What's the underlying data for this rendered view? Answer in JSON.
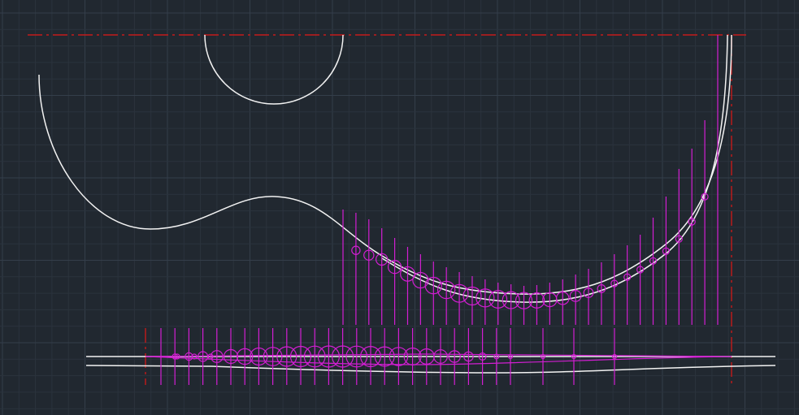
{
  "app": {
    "kind": "cad-drawing-viewport",
    "background": "#212830"
  },
  "layers": {
    "grid": {
      "minor_color": "#2b333d",
      "major_color": "#343e4a"
    },
    "geometry": {
      "color": "#f2f2f2"
    },
    "construction": {
      "color": "#d21ed2"
    },
    "centerline": {
      "color": "#c41a1a",
      "linetype": "dash-dot"
    }
  },
  "entities": {
    "circle_arc": "semicircle-arc",
    "spline": "s-curve-spline",
    "bowl_outer": "bowl-arc-outer",
    "bowl_inner": "bowl-arc-inner",
    "strip": "flat-strip-profile",
    "station_circles": "station-circles",
    "station_lines": "station-lines"
  }
}
